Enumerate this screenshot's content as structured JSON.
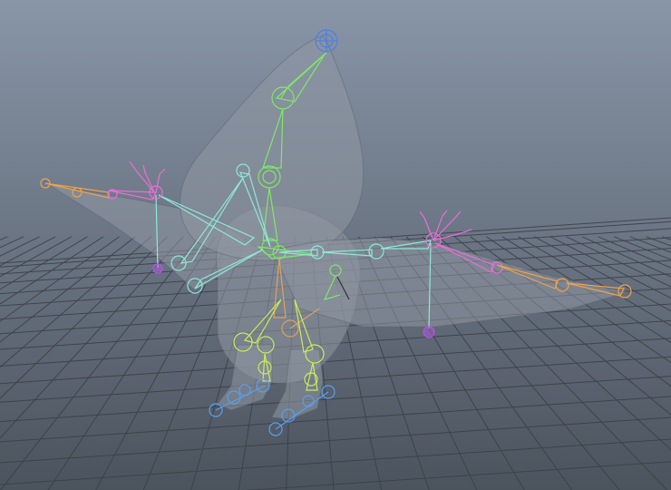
{
  "viewport": {
    "background_top": "#8996a8",
    "background_bottom": "#4b535d",
    "grid_color": "#3b4048",
    "mesh_fill": "#8f97a3",
    "mesh_stroke": "#5c636d"
  },
  "rig": {
    "spine_color": "#7ee86a",
    "arm_color": "#8fe8d8",
    "leg_color": "#c9ec5a",
    "hip_color": "#e0a060",
    "finger_color": "#e86fd6",
    "wing_tip_color": "#f0a24a",
    "head_control_color": "#4f7fe0",
    "foot_control_color": "#5a9ff0",
    "pole_color": "#b455e0"
  }
}
